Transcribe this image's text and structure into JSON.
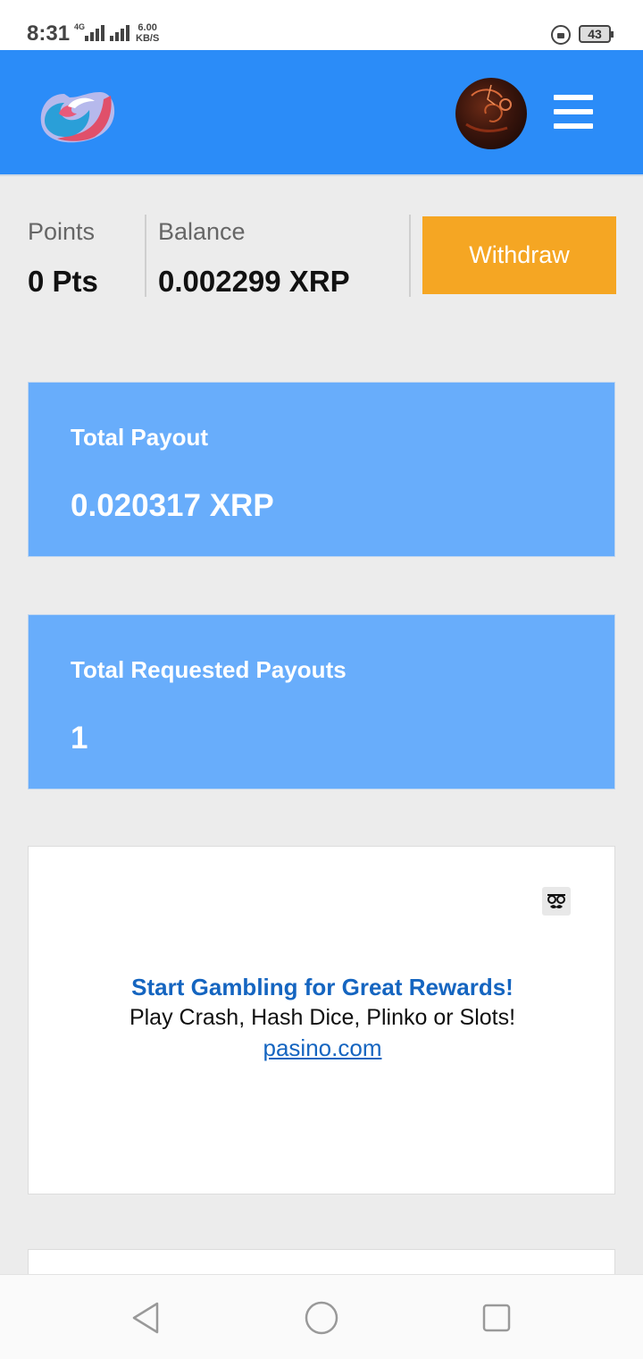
{
  "status_bar": {
    "time": "8:31",
    "network": "4G",
    "speed_value": "6.00",
    "speed_unit": "KB/S",
    "battery": "43"
  },
  "header": {
    "logo_icon": "app-logo",
    "avatar_icon": "user-avatar",
    "menu_icon": "hamburger-menu-icon",
    "background_color": "#2b8cf8"
  },
  "stats": {
    "points_label": "Points",
    "points_value": "0 Pts",
    "balance_label": "Balance",
    "balance_value": "0.002299 XRP",
    "withdraw_label": "Withdraw",
    "withdraw_color": "#f5a623"
  },
  "cards": {
    "total_payout_title": "Total Payout",
    "total_payout_value": "0.020317 XRP",
    "total_requested_title": "Total Requested Payouts",
    "total_requested_value": "1",
    "card_color": "#68adfb"
  },
  "ad": {
    "icon": "disguise-glasses-icon",
    "headline": "Start Gambling for Great Rewards!",
    "body": "Play Crash, Hash Dice, Plinko or Slots!",
    "link": "pasino.com"
  },
  "nav_bar": {
    "back_icon": "back-triangle-icon",
    "home_icon": "home-circle-icon",
    "recents_icon": "recents-square-icon"
  }
}
